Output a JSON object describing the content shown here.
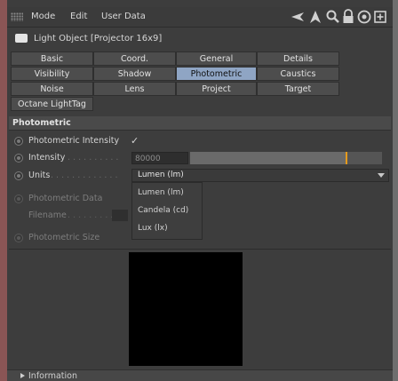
{
  "menubar": {
    "items": [
      "Mode",
      "Edit",
      "User Data"
    ],
    "icons": [
      "back-arrow-icon",
      "up-arrow-icon",
      "search-icon",
      "lock-icon",
      "target-icon",
      "new-panel-icon"
    ]
  },
  "object": {
    "title": "Light Object [Projector 16x9]"
  },
  "tabs": {
    "row1": [
      "Basic",
      "Coord.",
      "General",
      "Details"
    ],
    "row2": [
      "Visibility",
      "Shadow",
      "Photometric",
      "Caustics"
    ],
    "row3": [
      "Noise",
      "Lens",
      "Project",
      "Target"
    ],
    "row4": [
      "Octane LightTag"
    ],
    "active": "Photometric"
  },
  "section": {
    "title": "Photometric",
    "photometric_intensity": {
      "label": "Photometric Intensity",
      "checked": true,
      "check_glyph": "✓"
    },
    "intensity": {
      "label": "Intensity",
      "value": "80000",
      "slider_fraction": 0.82
    },
    "units": {
      "label": "Units",
      "selected": "Lumen (lm)"
    },
    "photometric_data": {
      "label": "Photometric Data"
    },
    "filename": {
      "label": "Filename"
    },
    "photometric_size": {
      "label": "Photometric Size"
    }
  },
  "units_dropdown": {
    "options": [
      "Lumen (lm)",
      "Candela (cd)",
      "Lux (lx)"
    ]
  },
  "footer": {
    "label": "Information"
  },
  "colors": {
    "active_tab": "#8fa5c4",
    "slider_marker": "#e59a1c",
    "panel_bg": "#3d3d3d"
  }
}
